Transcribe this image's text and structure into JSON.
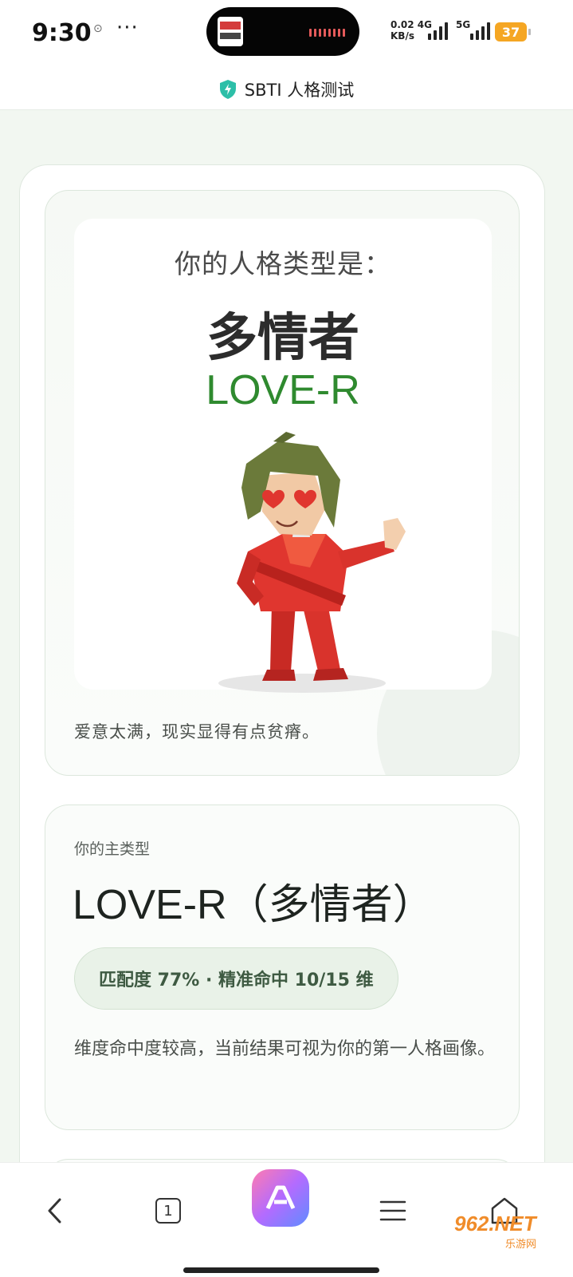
{
  "status_bar": {
    "time": "9:30",
    "dots": "···",
    "net_speed_value": "0.02",
    "net_speed_unit": "KB/s",
    "net_4g": "4G",
    "net_5g": "5G",
    "battery": "37"
  },
  "header": {
    "title": "SBTI 人格测试",
    "accent": "#2dbfa8"
  },
  "result_card": {
    "poster_heading": "你的人格类型是：",
    "poster_name": "多情者",
    "poster_code": "LOVE-R",
    "description": "爱意太满，现实显得有点贫瘠。"
  },
  "type_card": {
    "label": "你的主类型",
    "title": "LOVE-R（多情者）",
    "match": "匹配度 77% · 精准命中 10/15 维",
    "description": "维度命中度较高，当前结果可视为你的第一人格画像。"
  },
  "bottom_nav": {
    "tab_count": "1"
  },
  "watermark": {
    "main": "962.NET",
    "sub": "乐游网"
  },
  "colors": {
    "code_green": "#2f8a2f",
    "character_red": "#e0362f",
    "hair_olive": "#6b7a3a"
  }
}
